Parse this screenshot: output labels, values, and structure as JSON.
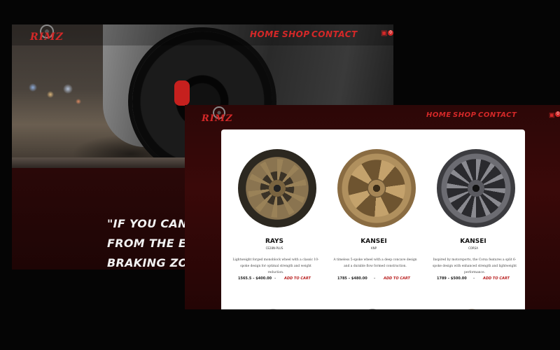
{
  "brand": {
    "logo_text": "RIMZ"
  },
  "nav": {
    "home": "HOME",
    "shop": "SHOP",
    "contact": "CONTACT",
    "cart_count": "0"
  },
  "hero": {
    "quote_lines": [
      "\"IF YOU CAN LEAVE",
      "FROM THE EXIT OF",
      "BRAKING ZONE OF"
    ]
  },
  "products": [
    {
      "brand": "RAYS",
      "model": "CE28N-PLUS",
      "description": "Lightweight forged monoblock wheel with a classic 10-spoke design for optimal strength and weight reduction.",
      "price": "1565.5 – $400.00",
      "button": "ADD TO CART",
      "color": "#7a6a4a"
    },
    {
      "brand": "KANSEI",
      "model": "KNP",
      "description": "A timeless 5-spoke wheel with a deep concave design and a durable flow formed construction.",
      "price": "1785 – $480.00",
      "button": "ADD TO CART",
      "color": "#9c7e52"
    },
    {
      "brand": "KANSEI",
      "model": "CORSA",
      "description": "Inspired by motorsports, the Corsa features a split 6-spoke design with enhanced strength and lightweight performance.",
      "price": "1789 – $500.00",
      "button": "ADD TO CART",
      "color": "#5a5a5e"
    }
  ],
  "icons": {
    "cart": "cart-icon",
    "chevron": "chevron-down-icon"
  },
  "colors": {
    "accent": "#d42828",
    "background": "#050505",
    "panel": "#ffffff"
  }
}
